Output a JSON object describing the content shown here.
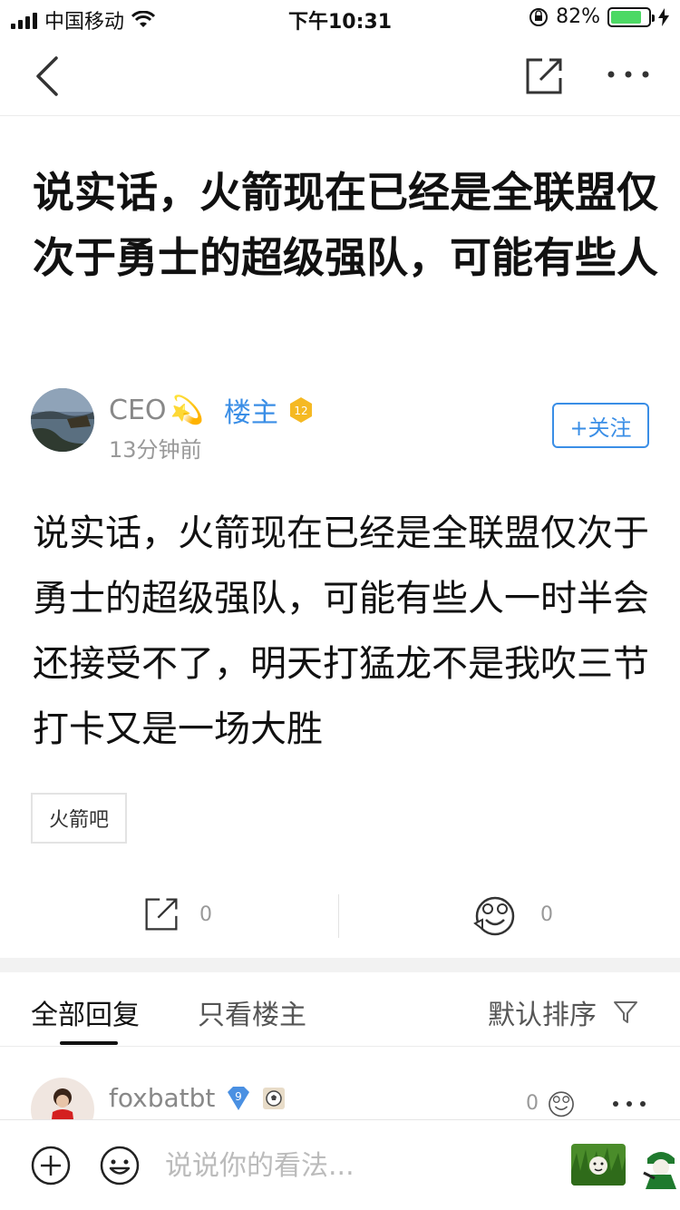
{
  "status_bar": {
    "carrier": "中国移动",
    "time": "下午10:31",
    "battery_percent": "82%",
    "battery_level": 0.82,
    "battery_color": "#4cd964"
  },
  "nav": {
    "back_icon": "chevron-left-icon",
    "share_icon": "share-icon",
    "more_icon": "more-icon"
  },
  "post": {
    "title": "说实话，火箭现在已经是全联盟仅次于勇士的超级强队，可能有些人",
    "author": {
      "name": "CEO",
      "name_emoji": "💫",
      "owner_label": "楼主",
      "level": "12",
      "time": "13分钟前",
      "follow_label": "+关注"
    },
    "body": "说实话，火箭现在已经是全联盟仅次于勇士的超级强队，可能有些人一时半会还接受不了，明天打猛龙不是我吹三节打卡又是一场大胜",
    "tag": "火箭吧",
    "share_count": "0",
    "like_count": "0"
  },
  "reply_tabs": {
    "all": "全部回复",
    "owner_only": "只看楼主",
    "sort": "默认排序"
  },
  "replies": [
    {
      "name": "foxbatbt",
      "level": "9",
      "like_count": "0"
    }
  ],
  "input_bar": {
    "placeholder": "说说你的看法..."
  },
  "colors": {
    "accent": "#3a8ee6",
    "level_badge": "#f5b923",
    "reply_badge": "#4a90e2"
  }
}
